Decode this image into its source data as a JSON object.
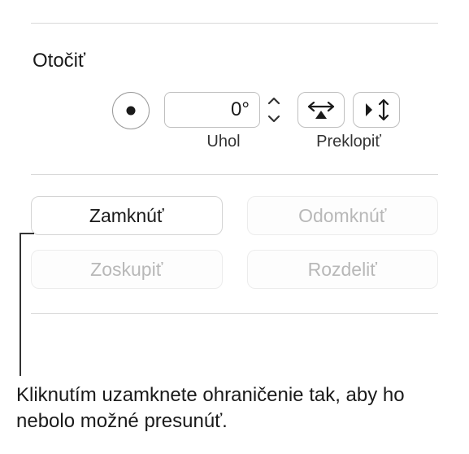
{
  "rotate": {
    "title": "Otočiť",
    "angle_value": "0°",
    "angle_label": "Uhol",
    "flip_label": "Preklopiť"
  },
  "actions": {
    "lock": "Zamknúť",
    "unlock": "Odomknúť",
    "group": "Zoskupiť",
    "ungroup": "Rozdeliť"
  },
  "callout": {
    "text": "Kliknutím uzamknete ohraničenie tak, aby ho nebolo možné presunúť."
  }
}
